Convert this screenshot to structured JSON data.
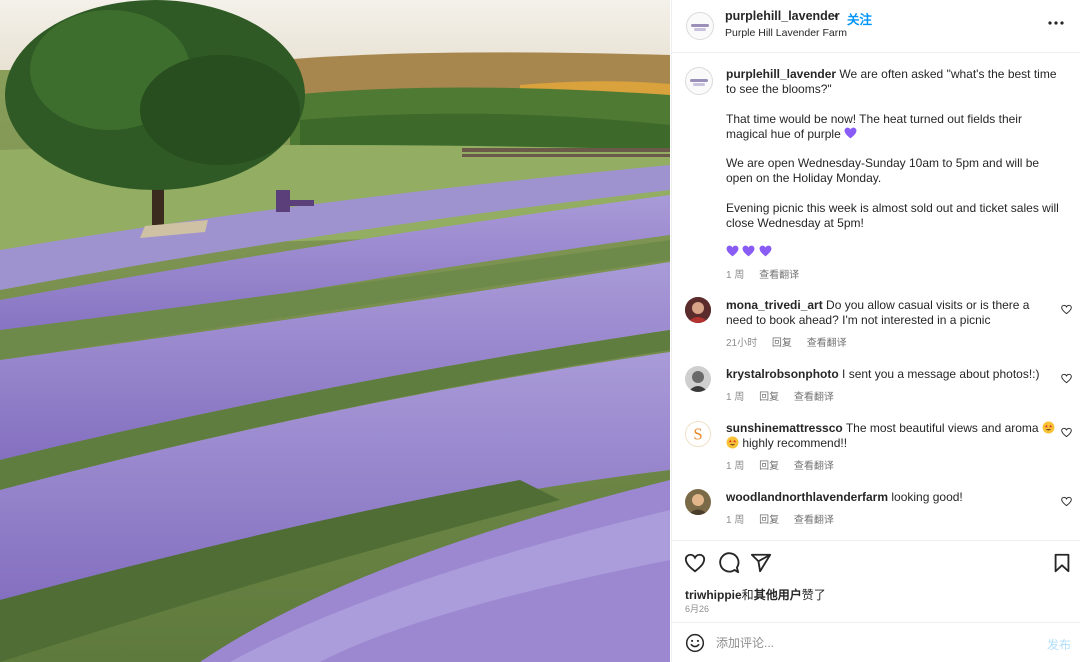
{
  "post": {
    "username": "purplehill_lavender",
    "follow_label": "关注",
    "subtitle": "Purple Hill Lavender Farm",
    "caption_username": "purplehill_lavender",
    "caption_p1": "We are often asked \"what's the best time to see the blooms?\"",
    "caption_p2": "That time would be now! The heat turned out fields their magical hue of purple",
    "caption_p3": "We are open Wednesday-Sunday 10am to 5pm and will be open on the Holiday Monday.",
    "caption_p4": "Evening picnic this week is almost sold out and ticket sales will close Wednesday at 5pm!",
    "caption_time": "1 周",
    "caption_translate": "查看翻译"
  },
  "comments": [
    {
      "username": "mona_trivedi_art",
      "text": "Do you allow casual visits or is there a need to book ahead? I'm not interested in a picnic",
      "time": "21小时",
      "reply": "回复",
      "translate": "查看翻译"
    },
    {
      "username": "krystalrobsonphoto",
      "text": "I sent you a message about photos!:)",
      "time": "1 周",
      "reply": "回复",
      "translate": "查看翻译"
    },
    {
      "username": "sunshinemattressco",
      "text_a": "The most beautiful views and aroma",
      "text_b": "highly recommend!!",
      "time": "1 周",
      "reply": "回复",
      "translate": "查看翻译"
    },
    {
      "username": "woodlandnorthlavenderfarm",
      "text": "looking good!",
      "time": "1 周",
      "reply": "回复",
      "translate": "查看翻译"
    }
  ],
  "likes": {
    "user": "triwhippie",
    "connector": "和",
    "others": "其他用户",
    "suffix": "赞了"
  },
  "date": "6月26",
  "add_comment": {
    "placeholder": "添加评论...",
    "post_label": "发布"
  },
  "colors": {
    "accent": "#0095f6",
    "heart_purple": "#8a5cf6",
    "post_disabled": "#b2dffc"
  },
  "icons": [
    "more-icon",
    "like-icon",
    "comment-icon",
    "share-icon",
    "save-icon",
    "emoji-icon",
    "heart-outline-icon"
  ]
}
